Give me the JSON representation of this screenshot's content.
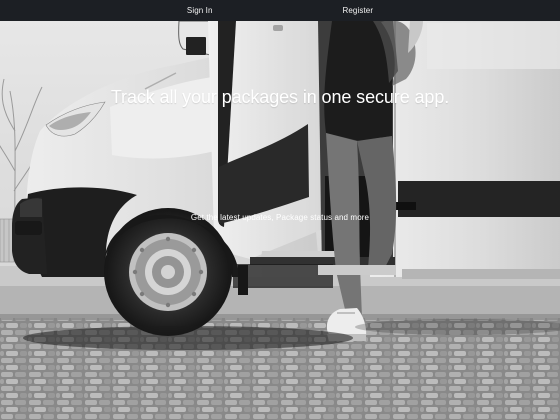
{
  "nav": {
    "sign_in": "Sign In",
    "register": "Register"
  },
  "hero": {
    "headline": "Track all your packages in one secure app.",
    "subtext": "Get the latest updates, Package status and more"
  },
  "colors": {
    "topbar": "#1c1f24",
    "text": "#ffffff"
  }
}
